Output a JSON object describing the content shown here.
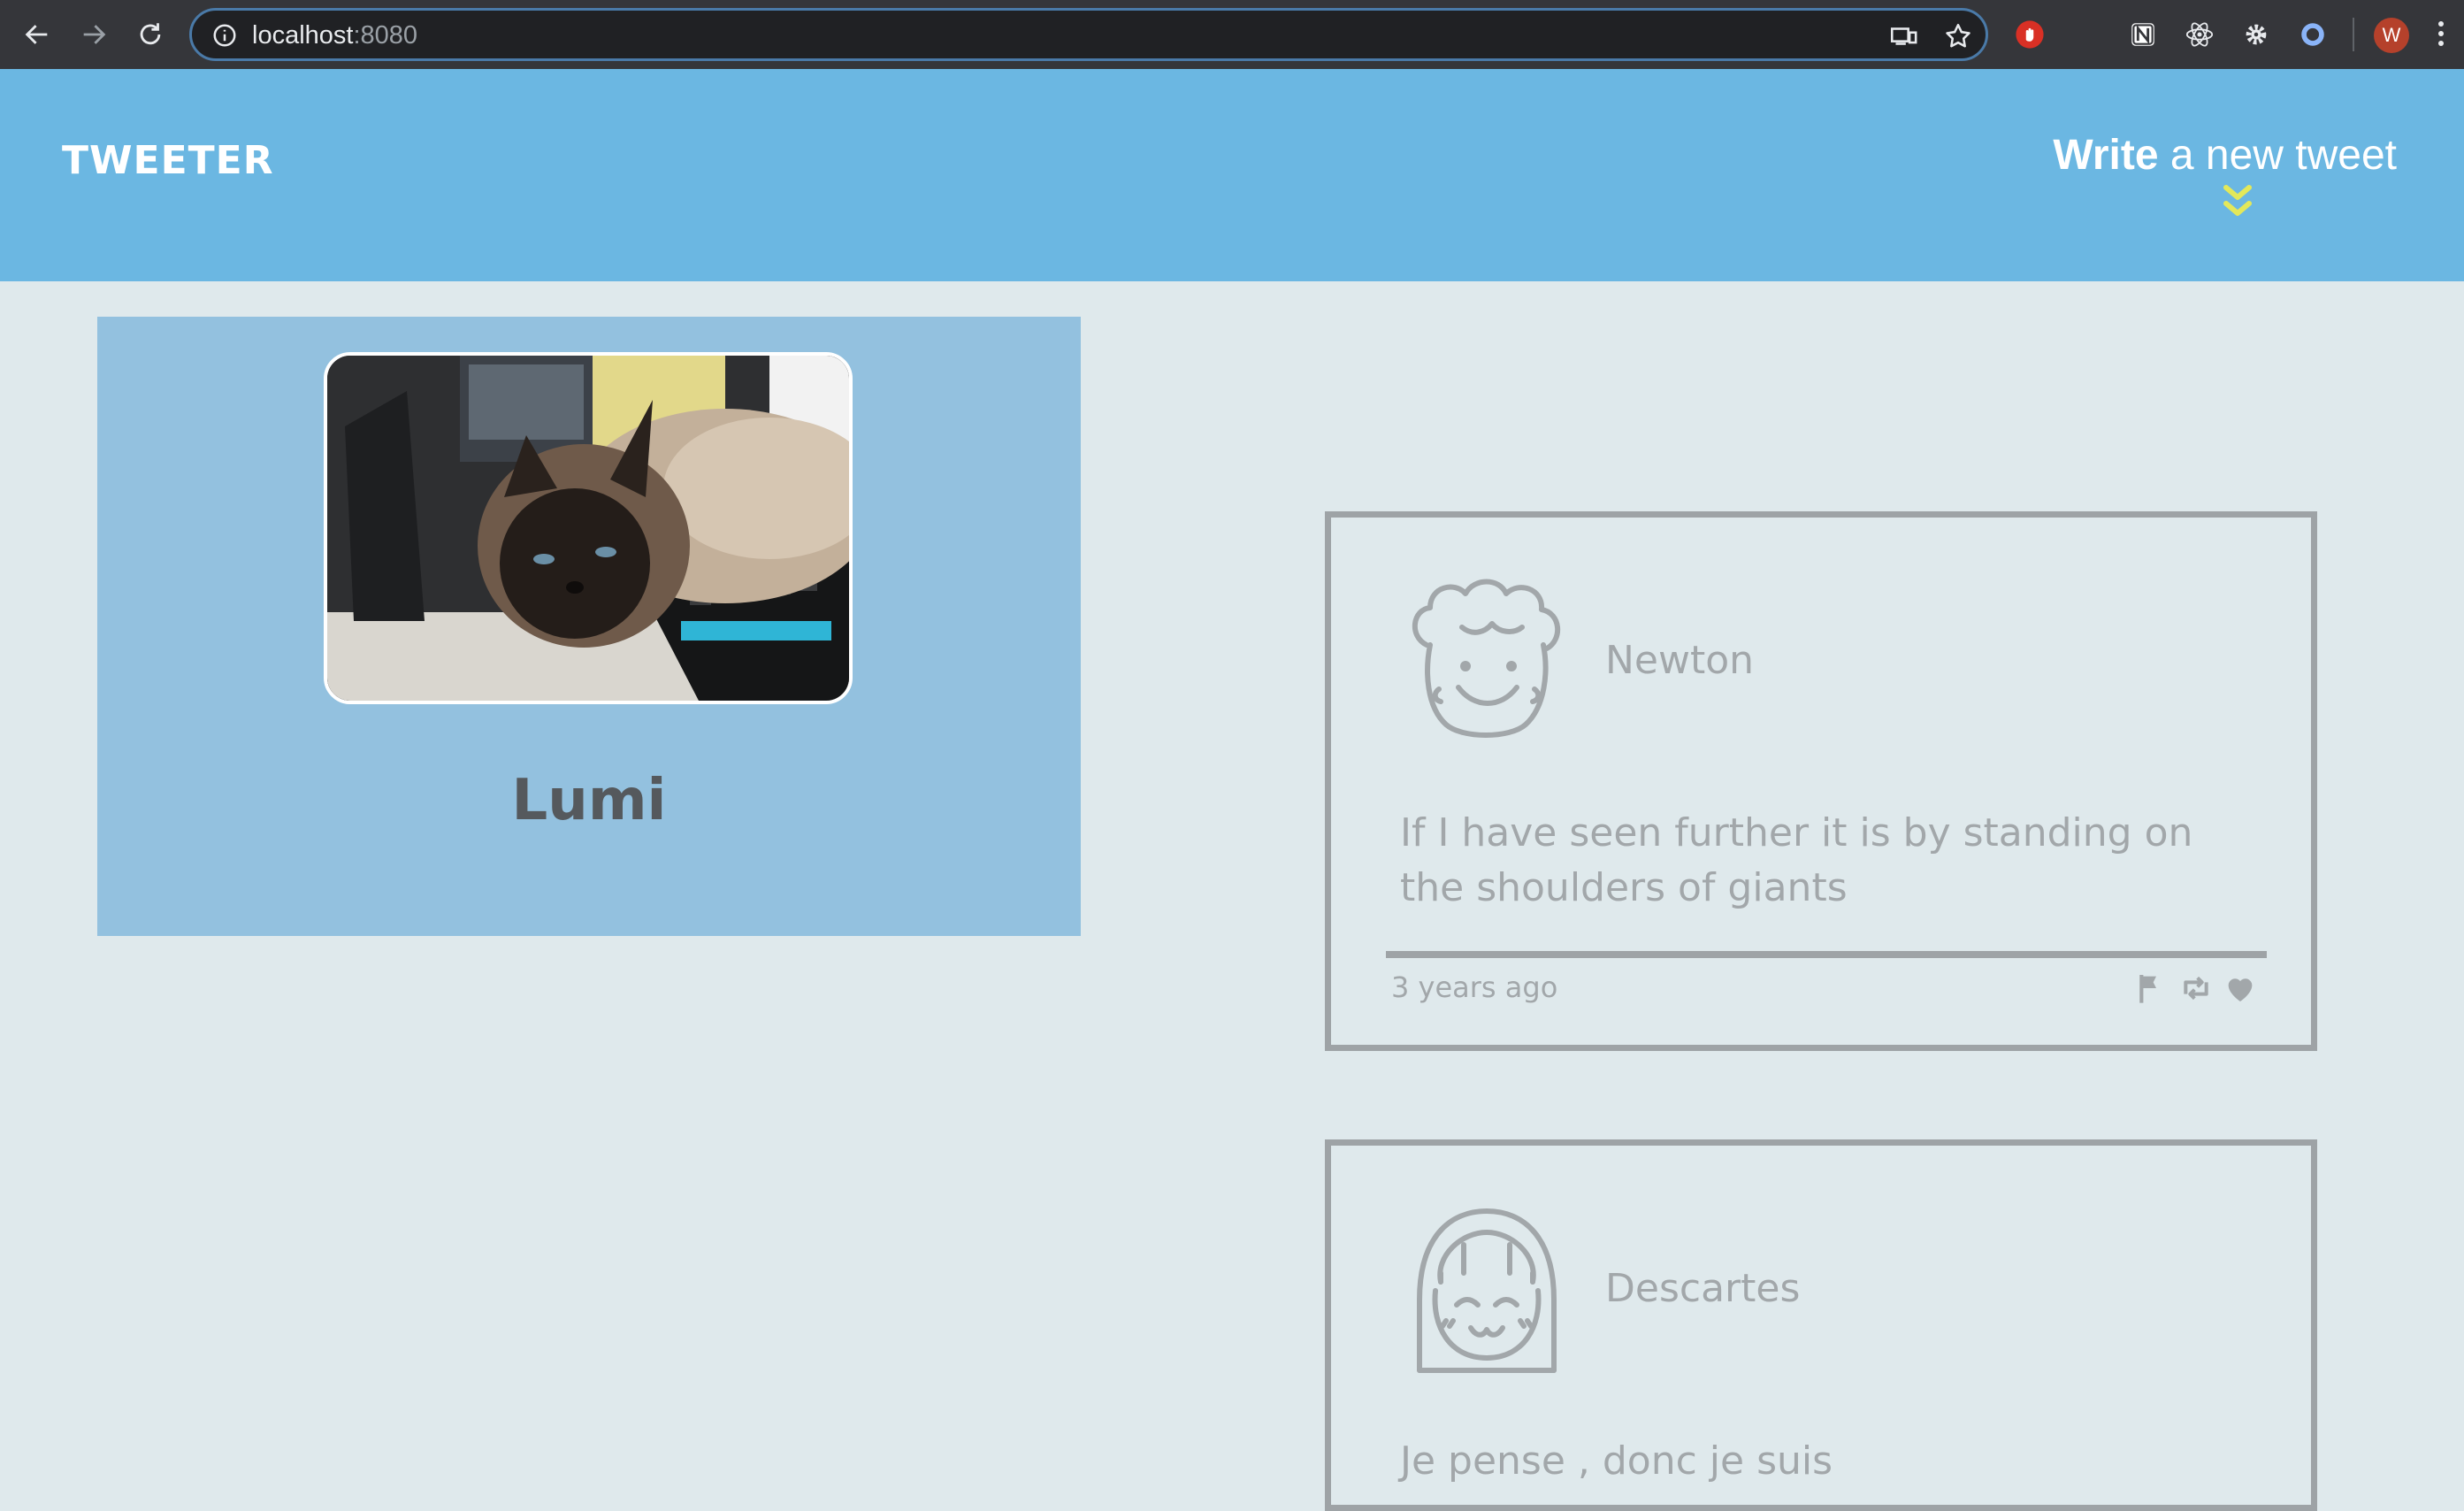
{
  "browser": {
    "url_host": "localhost",
    "url_port": ":8080",
    "profile_initial": "W"
  },
  "header": {
    "logo": "TWEETER",
    "write_bold": "Write",
    "write_rest": " a new tweet"
  },
  "profile": {
    "name": "Lumi"
  },
  "tweets": [
    {
      "author": "Newton",
      "text": "If I have seen further it is by standing on the shoulders of giants",
      "time": "3 years ago"
    },
    {
      "author": "Descartes",
      "text": "Je pense , donc je suis"
    }
  ],
  "colors": {
    "header_bg": "#6bb7e2",
    "profile_bg": "#93c1df",
    "page_bg": "#dfe9ec",
    "muted_gray": "#a2a7aa",
    "accent_yellow": "#e3e85a"
  }
}
